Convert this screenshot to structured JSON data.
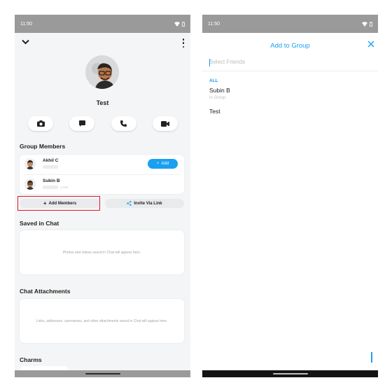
{
  "left_screen": {
    "status_time": "11:50",
    "group_name": "Test",
    "group_members_title": "Group Members",
    "members": [
      {
        "name": "Akhil C",
        "add_label": "Add"
      },
      {
        "name": "Subin B",
        "score": "1,418"
      }
    ],
    "add_members_label": "Add Members",
    "invite_link_label": "Invite Via Link",
    "saved_in_chat_title": "Saved in Chat",
    "saved_in_chat_empty": "Photos and videos saved in Chat will appear here.",
    "attachments_title": "Chat Attachments",
    "attachments_empty": "Links, addresses, usernames, and other attachments saved in Chat will appear here.",
    "charms_title": "Charms"
  },
  "right_screen": {
    "status_time": "11:50",
    "title": "Add to Group",
    "search_placeholder": "Select Friends",
    "section_label": "ALL",
    "items": [
      {
        "name": "Subin B",
        "subtitle": "In Group"
      },
      {
        "name": "Test"
      }
    ]
  },
  "colors": {
    "accent": "#1aa0f0",
    "highlight_box": "#e0192a",
    "status_bar": "#9a9a9a"
  }
}
